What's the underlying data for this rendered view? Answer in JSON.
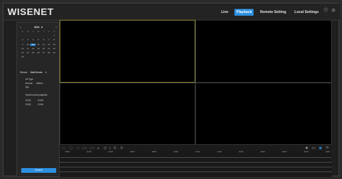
{
  "app": {
    "logo": "WISENET"
  },
  "nav": {
    "items": [
      {
        "label": "Live",
        "active": false
      },
      {
        "label": "Playback",
        "active": true
      },
      {
        "label": "Remote Setting",
        "active": false
      },
      {
        "label": "Local Settings",
        "active": false
      }
    ],
    "icons": [
      "info-icon",
      "power-icon"
    ]
  },
  "calendar": {
    "prev": "<",
    "year": "2019",
    "month": "6",
    "next": ">",
    "weekdays": [
      "S",
      "M",
      "T",
      "W",
      "T",
      "F",
      "S"
    ],
    "days": [
      "",
      "",
      "",
      "",
      "",
      "",
      "1",
      "2",
      "3",
      "4",
      "5",
      "6",
      "7",
      "8",
      "9",
      "10",
      "11",
      "12",
      "13",
      "14",
      "15",
      "16",
      "17",
      "18",
      "19",
      "20",
      "21",
      "22",
      "23",
      "24",
      "25",
      "26",
      "27",
      "28",
      "29",
      "30",
      "",
      "",
      "",
      "",
      "",
      ""
    ],
    "selected_day": "11"
  },
  "stream": {
    "label": "Stream",
    "value": "MainStream",
    "chevron": "▾"
  },
  "filters": {
    "all_type": "All Type",
    "normal": "Normal",
    "motion": "Motion",
    "pir": "PIR",
    "sync": "Synchronous playback"
  },
  "channels": [
    "CH01",
    "CH03",
    "CH02",
    "CH04"
  ],
  "search_label": "Search",
  "controls": {
    "left": [
      "▷",
      "▢",
      "◁",
      "▷▷",
      "◁◁",
      "▲",
      "▤",
      "⧉",
      "⧉"
    ],
    "right": [
      "⊕",
      "▭",
      "▣",
      "⤧"
    ]
  },
  "timeline": {
    "ticks": [
      "00:00",
      "02:00",
      "04:00",
      "06:00",
      "08:00",
      "10:00",
      "12:00",
      "14:00",
      "16:00",
      "18:00",
      "20:00",
      "22:00",
      "24:00"
    ],
    "channels": [
      "1",
      "2",
      "3",
      "4"
    ]
  },
  "colors": {
    "accent": "#2d8fe0",
    "selected_tile_border": "#8c8a3c"
  }
}
